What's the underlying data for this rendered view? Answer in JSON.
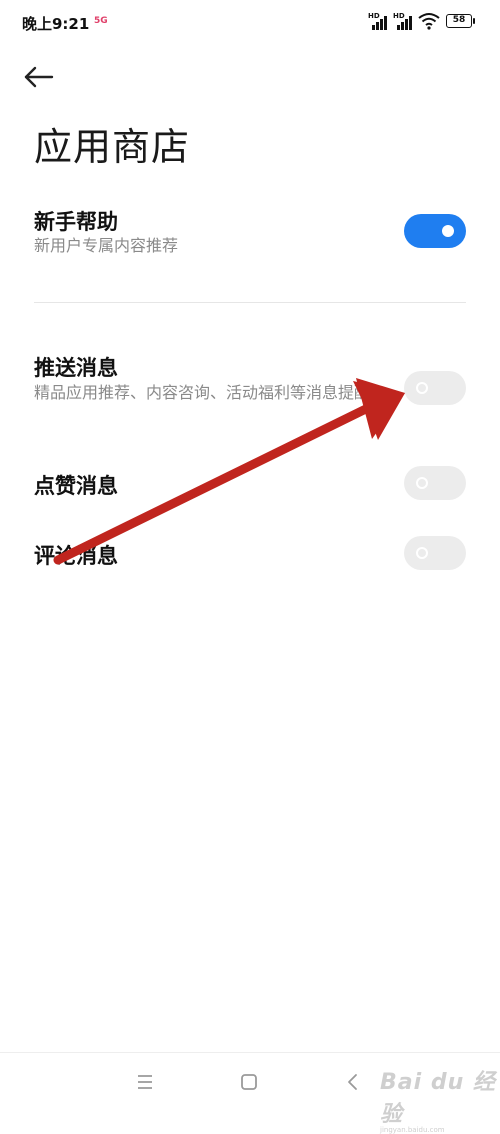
{
  "status_bar": {
    "time": "晚上9:21",
    "network_badge": "5G",
    "signal_label_1": "HD",
    "signal_label_2": "HD",
    "battery": "58"
  },
  "header": {
    "title": "应用商店"
  },
  "settings": {
    "newbie_help": {
      "title": "新手帮助",
      "subtitle": "新用户专属内容推荐",
      "enabled": true
    },
    "push_messages": {
      "title": "推送消息",
      "subtitle": "精品应用推荐、内容咨询、活动福利等消息提醒",
      "enabled": false
    },
    "like_messages": {
      "title": "点赞消息",
      "enabled": false
    },
    "comment_messages": {
      "title": "评论消息",
      "enabled": false
    }
  },
  "annotation": {
    "arrow_color": "#c0251e"
  },
  "colors": {
    "toggle_on": "#1f7ef0",
    "toggle_off": "#ececec"
  },
  "nav_bar": {
    "icons": [
      "menu-icon",
      "home-icon",
      "back-icon"
    ]
  },
  "watermark": {
    "text": "Bai du 经验",
    "sub": "jingyan.baidu.com"
  }
}
